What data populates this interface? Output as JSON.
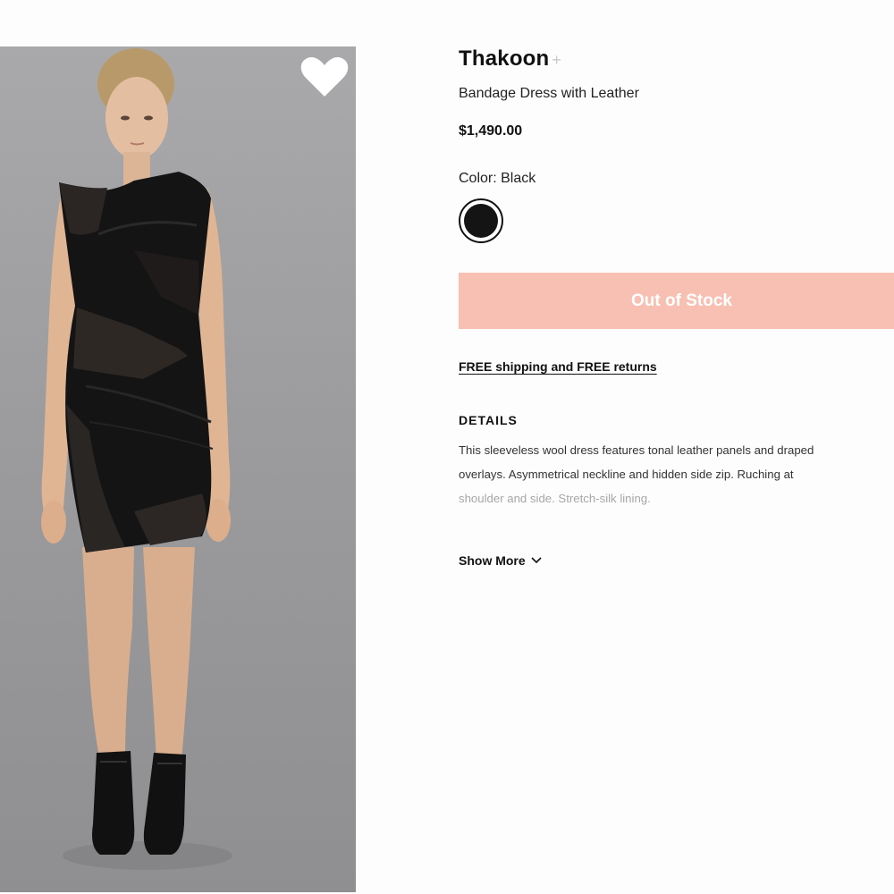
{
  "product": {
    "brand": "Thakoon",
    "brand_follow": "+",
    "name": "Bandage Dress with Leather",
    "price": "$1,490.00",
    "color_label": "Color: Black",
    "swatch_color": "#141414",
    "stock_button": "Out of Stock",
    "shipping_link": "FREE shipping and FREE returns",
    "details_heading": "DETAILS",
    "details_lines": [
      "This sleeveless wool dress features tonal leather panels and draped",
      "overlays. Asymmetrical neckline and hidden side zip. Ruching at",
      "shoulder and side. Stretch-silk lining."
    ],
    "show_more": "Show More"
  },
  "colors": {
    "button_bg": "#f8c0b3",
    "button_text": "#ffffff",
    "image_bg": "#a3a3a5"
  },
  "icons": {
    "favorite": "heart-icon",
    "show_more": "chevron-down-icon"
  }
}
